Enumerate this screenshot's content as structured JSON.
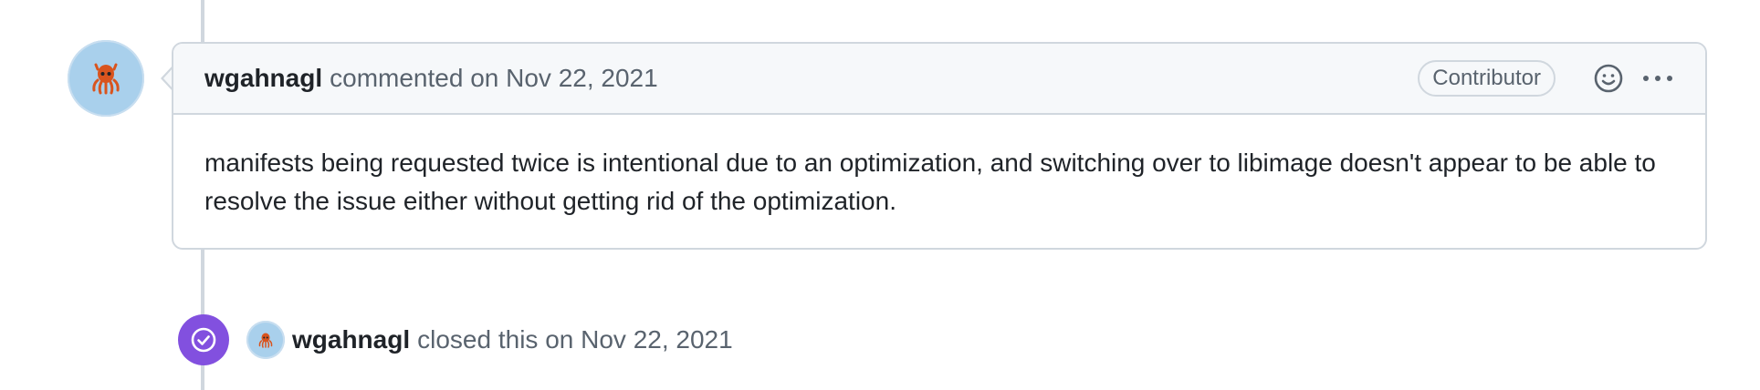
{
  "comment": {
    "author": "wgahnagl",
    "action": "commented on Nov 22, 2021",
    "badge": "Contributor",
    "body": "manifests being requested twice is intentional due to an optimization, and switching over to libimage doesn't appear to be able to resolve the issue either without getting rid of the optimization.",
    "avatar_icon": "octocat-avatar",
    "reaction_icon": "smiley-icon",
    "menu_icon": "kebab-horizontal-icon"
  },
  "event": {
    "author": "wgahnagl",
    "action": "closed this on Nov 22, 2021",
    "icon": "issue-closed-icon",
    "badge_color": "#8250df"
  },
  "colors": {
    "avatar_bg": "#a9d0ec",
    "octocat": "#d9541e",
    "timeline": "#d0d7de"
  }
}
